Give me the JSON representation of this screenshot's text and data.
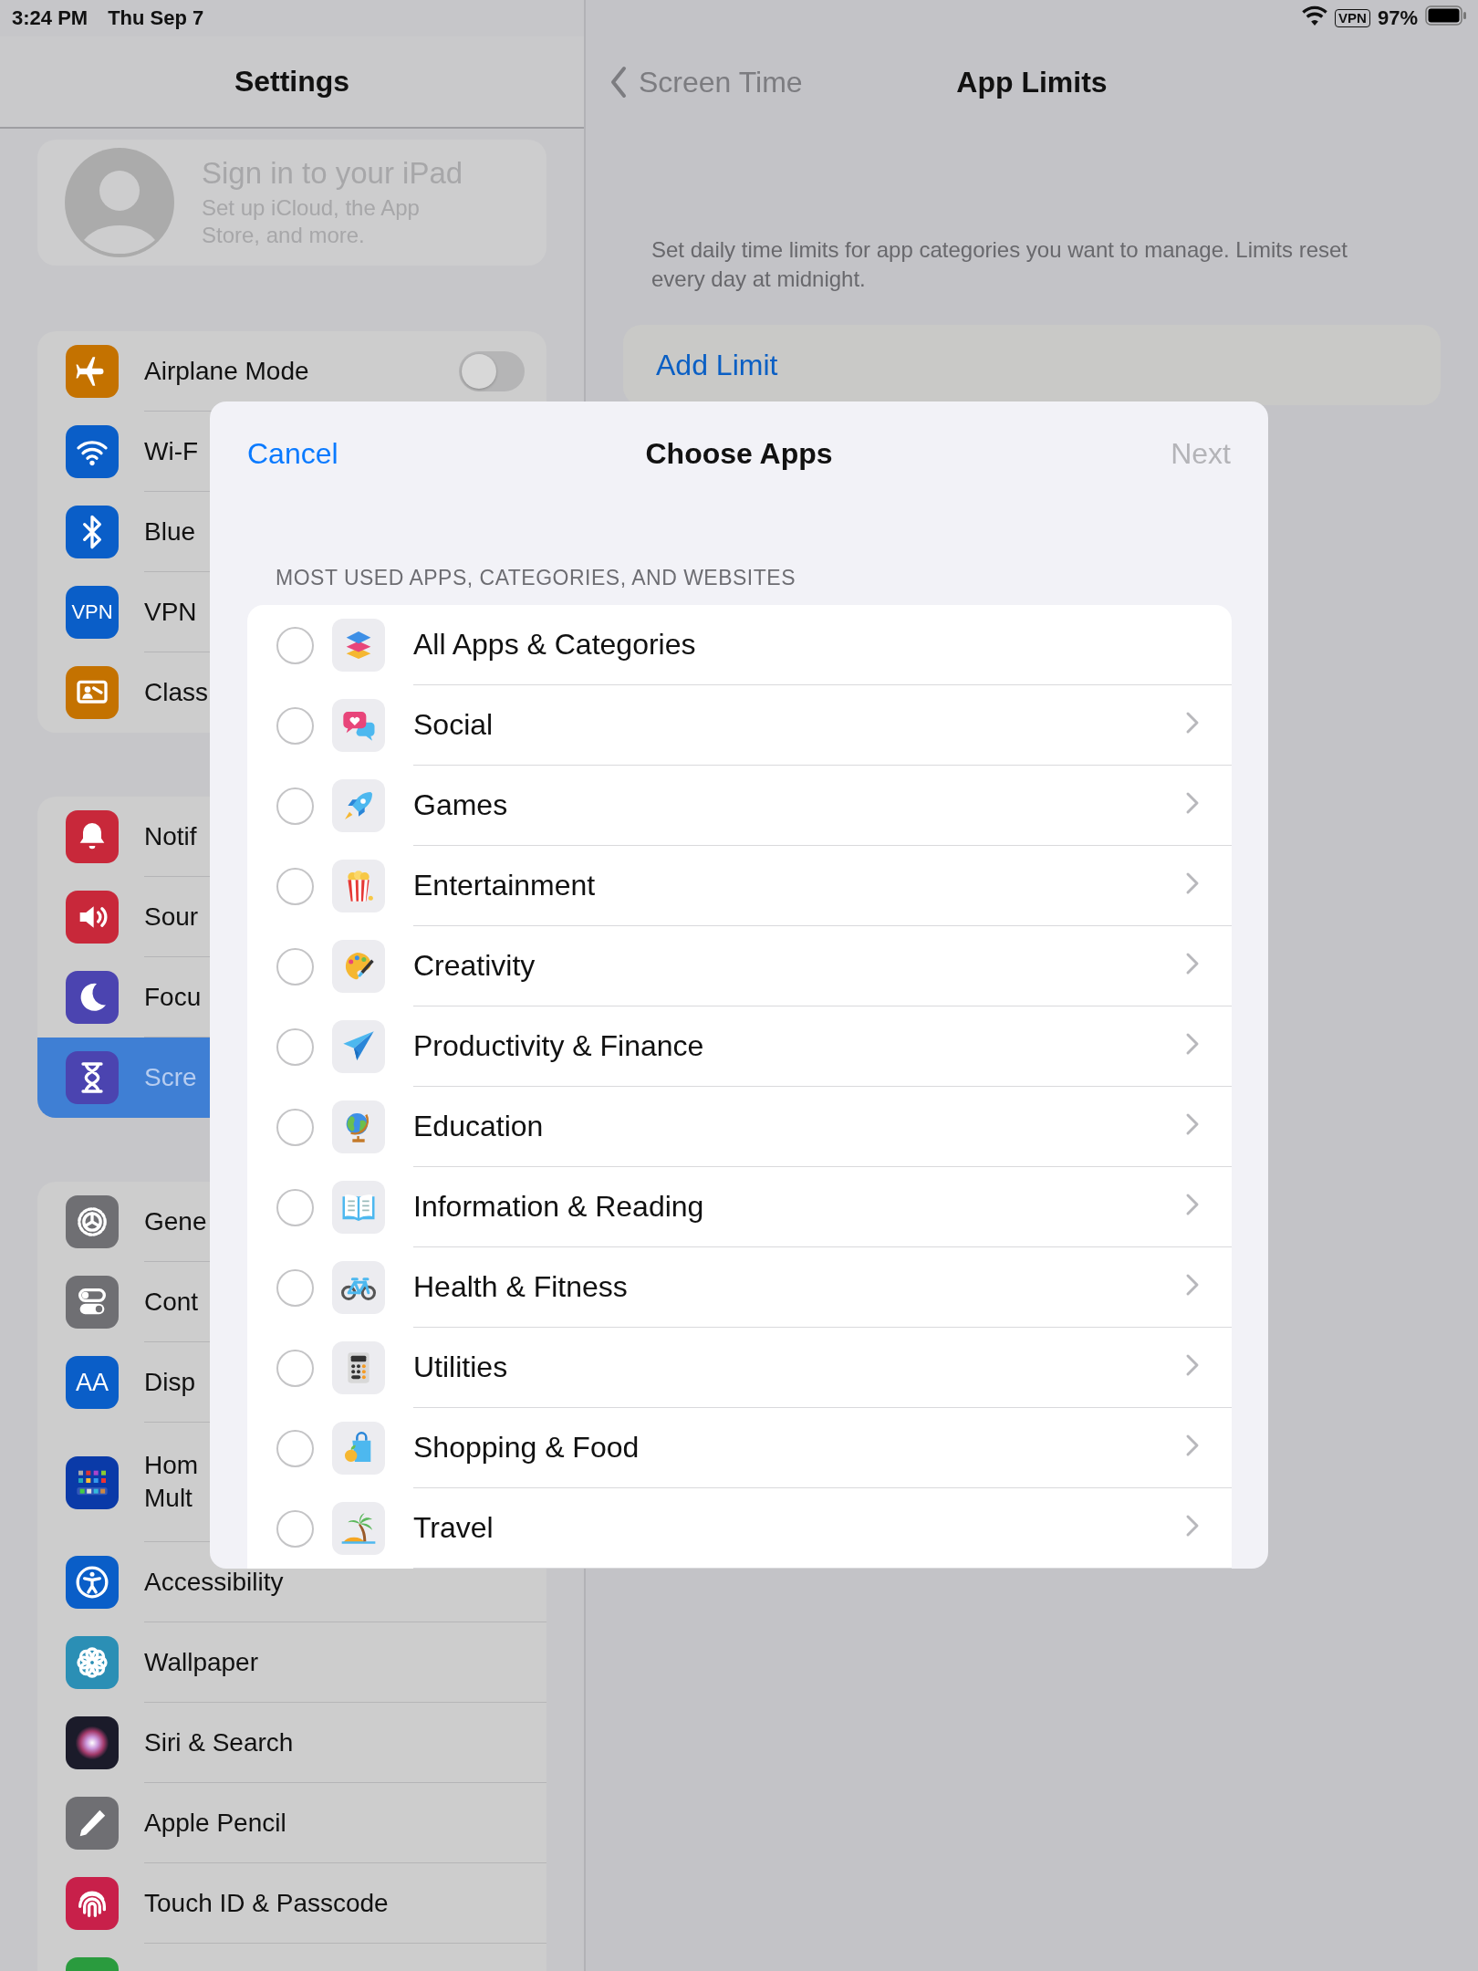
{
  "status_bar": {
    "time": "3:24 PM",
    "date": "Thu Sep 7",
    "vpn": "VPN",
    "battery": "97%"
  },
  "sidebar": {
    "title": "Settings",
    "profile": {
      "title": "Sign in to your iPad",
      "subtitle": "Set up iCloud, the App Store, and more."
    },
    "groups": [
      [
        {
          "kind": "toggle",
          "label": "Airplane Mode",
          "on": false,
          "selected": false
        },
        {
          "kind": "link",
          "label": "Wi-F",
          "selected": false
        },
        {
          "kind": "link",
          "label": "Blue",
          "selected": false
        },
        {
          "kind": "link",
          "label": "VPN",
          "icon_text": "VPN",
          "selected": false
        },
        {
          "kind": "link",
          "label": "Class",
          "selected": false
        }
      ],
      [
        {
          "kind": "link",
          "label": "Notif",
          "selected": false
        },
        {
          "kind": "link",
          "label": "Sour",
          "selected": false
        },
        {
          "kind": "link",
          "label": "Focu",
          "selected": false
        },
        {
          "kind": "link",
          "label": "Scre",
          "selected": true
        }
      ],
      [
        {
          "kind": "link",
          "label": "Gene",
          "selected": false
        },
        {
          "kind": "link",
          "label": "Cont",
          "selected": false
        },
        {
          "kind": "link",
          "label": "Disp",
          "icon_text": "AA",
          "selected": false
        },
        {
          "kind": "link",
          "label": "Hom\nMult",
          "selected": false
        },
        {
          "kind": "link",
          "label": "Accessibility",
          "selected": false
        },
        {
          "kind": "link",
          "label": "Wallpaper",
          "selected": false
        },
        {
          "kind": "link",
          "label": "Siri & Search",
          "selected": false
        },
        {
          "kind": "link",
          "label": "Apple Pencil",
          "selected": false
        },
        {
          "kind": "link",
          "label": "Touch ID & Passcode",
          "selected": false
        },
        {
          "kind": "link",
          "selected": false
        }
      ]
    ]
  },
  "detail": {
    "back": "Screen Time",
    "title": "App Limits",
    "description": "Set daily time limits for app categories you want to manage. Limits reset every day at midnight.",
    "add_button": "Add Limit"
  },
  "sheet": {
    "cancel": "Cancel",
    "title": "Choose Apps",
    "next": "Next",
    "next_disabled": true,
    "section": "MOST USED APPS, CATEGORIES, AND WEBSITES",
    "rows": [
      {
        "label": "All Apps & Categories",
        "selected": false,
        "expandable": false
      },
      {
        "label": "Social",
        "selected": false,
        "expandable": true
      },
      {
        "label": "Games",
        "selected": false,
        "expandable": true
      },
      {
        "label": "Entertainment",
        "selected": false,
        "expandable": true
      },
      {
        "label": "Creativity",
        "selected": false,
        "expandable": true
      },
      {
        "label": "Productivity & Finance",
        "selected": false,
        "expandable": true
      },
      {
        "label": "Education",
        "selected": false,
        "expandable": true
      },
      {
        "label": "Information & Reading",
        "selected": false,
        "expandable": true
      },
      {
        "label": "Health & Fitness",
        "selected": false,
        "expandable": true
      },
      {
        "label": "Utilities",
        "selected": false,
        "expandable": true
      },
      {
        "label": "Shopping & Food",
        "selected": false,
        "expandable": true
      },
      {
        "label": "Travel",
        "selected": false,
        "expandable": true
      }
    ]
  }
}
